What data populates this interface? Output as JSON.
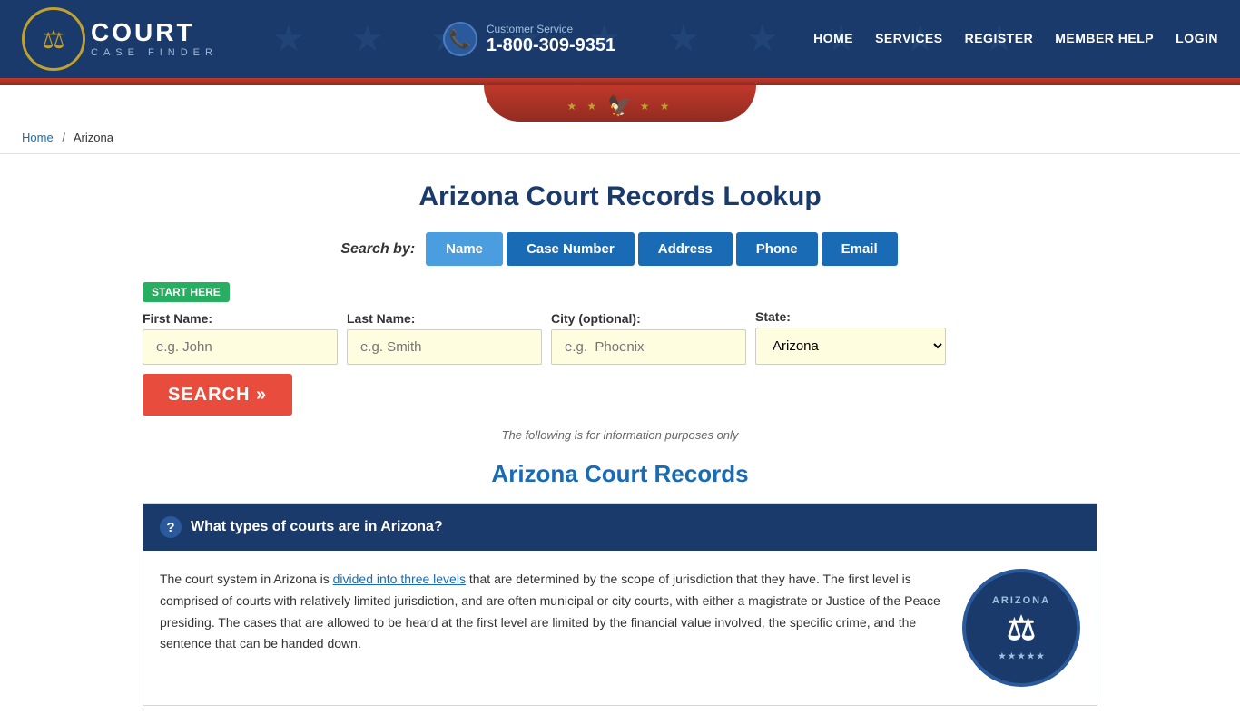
{
  "header": {
    "logo_court": "COURT",
    "logo_case_finder": "CASE FINDER",
    "customer_service_label": "Customer Service",
    "customer_service_phone": "1-800-309-9351",
    "nav": [
      {
        "label": "HOME",
        "id": "home"
      },
      {
        "label": "SERVICES",
        "id": "services"
      },
      {
        "label": "REGISTER",
        "id": "register"
      },
      {
        "label": "MEMBER HELP",
        "id": "member-help"
      },
      {
        "label": "LOGIN",
        "id": "login"
      }
    ]
  },
  "breadcrumb": {
    "home_label": "Home",
    "separator": "/",
    "current": "Arizona"
  },
  "main": {
    "page_title": "Arizona Court Records Lookup",
    "search_by_label": "Search by:",
    "search_tabs": [
      {
        "label": "Name",
        "active": true,
        "id": "tab-name"
      },
      {
        "label": "Case Number",
        "active": false,
        "id": "tab-case-number"
      },
      {
        "label": "Address",
        "active": false,
        "id": "tab-address"
      },
      {
        "label": "Phone",
        "active": false,
        "id": "tab-phone"
      },
      {
        "label": "Email",
        "active": false,
        "id": "tab-email"
      }
    ],
    "start_here_badge": "START HERE",
    "form": {
      "first_name_label": "First Name:",
      "first_name_placeholder": "e.g. John",
      "last_name_label": "Last Name:",
      "last_name_placeholder": "e.g. Smith",
      "city_label": "City (optional):",
      "city_placeholder": "e.g.  Phoenix",
      "state_label": "State:",
      "state_value": "Arizona",
      "state_options": [
        "Arizona"
      ],
      "search_button": "SEARCH »"
    },
    "info_note": "The following is for information purposes only",
    "section_heading": "Arizona Court Records",
    "faq": {
      "question": "What types of courts are in Arizona?",
      "answer_part1": "The court system in Arizona is ",
      "answer_link_text": "divided into three levels",
      "answer_part2": " that are determined by the scope of jurisdiction that they have. The first level is comprised of courts with relatively limited jurisdiction, and are often municipal or city courts, with either a magistrate or Justice of the Peace presiding. The cases that are allowed to be heard at the first level are limited by the financial value involved, the specific crime, and the sentence that can be handed down.",
      "seal_text_top": "ARIZONA",
      "seal_emblem": "⚖",
      "seal_text_bottom": "★ ★ ★ ★ ★"
    }
  }
}
